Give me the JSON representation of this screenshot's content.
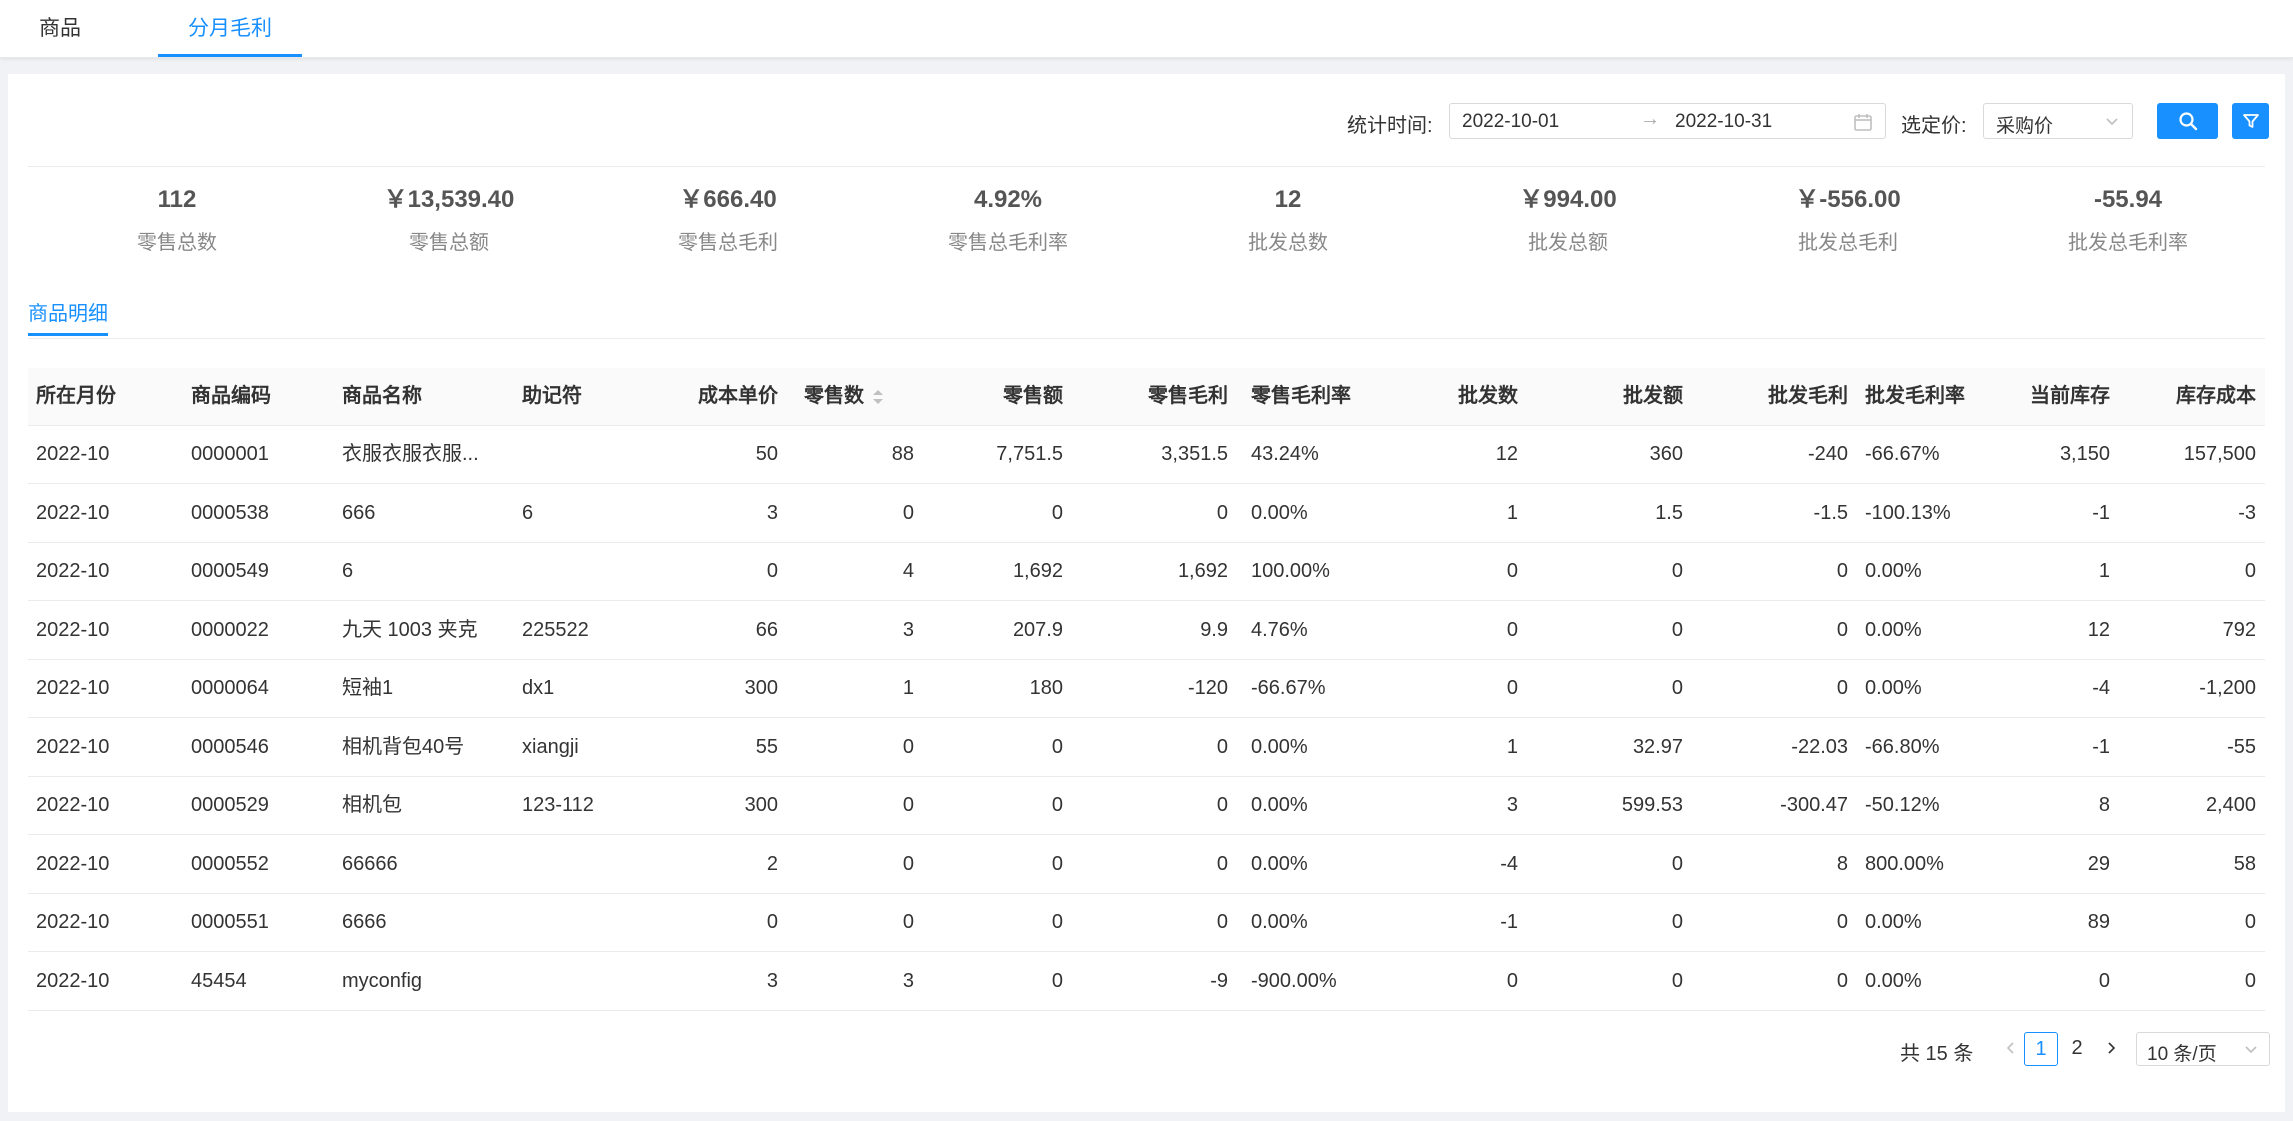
{
  "tabs": [
    {
      "label": "商品"
    },
    {
      "label": "分月毛利"
    }
  ],
  "filters": {
    "time_label": "统计时间:",
    "start_date": "2022-10-01",
    "end_date": "2022-10-31",
    "range_separator": "→",
    "price_label": "选定价:",
    "price_value": "采购价"
  },
  "stats": [
    {
      "value": "112",
      "label": "零售总数"
    },
    {
      "value": "￥13,539.40",
      "label": "零售总额"
    },
    {
      "value": "￥666.40",
      "label": "零售总毛利"
    },
    {
      "value": "4.92%",
      "label": "零售总毛利率"
    },
    {
      "value": "12",
      "label": "批发总数"
    },
    {
      "value": "￥994.00",
      "label": "批发总额"
    },
    {
      "value": "￥-556.00",
      "label": "批发总毛利"
    },
    {
      "value": "-55.94",
      "label": "批发总毛利率"
    }
  ],
  "sub_tab": "商品明细",
  "table": {
    "columns": [
      "所在月份",
      "商品编码",
      "商品名称",
      "助记符",
      "成本单价",
      "零售数",
      "零售额",
      "零售毛利",
      "零售毛利率",
      "批发数",
      "批发额",
      "批发毛利",
      "批发毛利率",
      "当前库存",
      "库存成本"
    ],
    "rows": [
      [
        "2022-10",
        "0000001",
        "衣服衣服衣服...",
        "",
        "50",
        "88",
        "7,751.5",
        "3,351.5",
        "43.24%",
        "12",
        "360",
        "-240",
        "-66.67%",
        "3,150",
        "157,500"
      ],
      [
        "2022-10",
        "0000538",
        "666",
        "6",
        "3",
        "0",
        "0",
        "0",
        "0.00%",
        "1",
        "1.5",
        "-1.5",
        "-100.13%",
        "-1",
        "-3"
      ],
      [
        "2022-10",
        "0000549",
        "6",
        "",
        "0",
        "4",
        "1,692",
        "1,692",
        "100.00%",
        "0",
        "0",
        "0",
        "0.00%",
        "1",
        "0"
      ],
      [
        "2022-10",
        "0000022",
        "九天 1003 夹克",
        "225522",
        "66",
        "3",
        "207.9",
        "9.9",
        "4.76%",
        "0",
        "0",
        "0",
        "0.00%",
        "12",
        "792"
      ],
      [
        "2022-10",
        "0000064",
        "短袖1",
        "dx1",
        "300",
        "1",
        "180",
        "-120",
        "-66.67%",
        "0",
        "0",
        "0",
        "0.00%",
        "-4",
        "-1,200"
      ],
      [
        "2022-10",
        "0000546",
        "相机背包40号",
        "xiangji",
        "55",
        "0",
        "0",
        "0",
        "0.00%",
        "1",
        "32.97",
        "-22.03",
        "-66.80%",
        "-1",
        "-55"
      ],
      [
        "2022-10",
        "0000529",
        "相机包",
        "123-112",
        "300",
        "0",
        "0",
        "0",
        "0.00%",
        "3",
        "599.53",
        "-300.47",
        "-50.12%",
        "8",
        "2,400"
      ],
      [
        "2022-10",
        "0000552",
        "66666",
        "",
        "2",
        "0",
        "0",
        "0",
        "0.00%",
        "-4",
        "0",
        "8",
        "800.00%",
        "29",
        "58"
      ],
      [
        "2022-10",
        "0000551",
        "6666",
        "",
        "0",
        "0",
        "0",
        "0",
        "0.00%",
        "-1",
        "0",
        "0",
        "0.00%",
        "89",
        "0"
      ],
      [
        "2022-10",
        "45454",
        "myconfig",
        "",
        "3",
        "3",
        "0",
        "-9",
        "-900.00%",
        "0",
        "0",
        "0",
        "0.00%",
        "0",
        "0"
      ]
    ]
  },
  "pagination": {
    "total_text": "共 15 条",
    "pages": [
      "1",
      "2"
    ],
    "current": "1",
    "page_size": "10 条/页"
  },
  "colors": {
    "accent": "#1890ff"
  }
}
